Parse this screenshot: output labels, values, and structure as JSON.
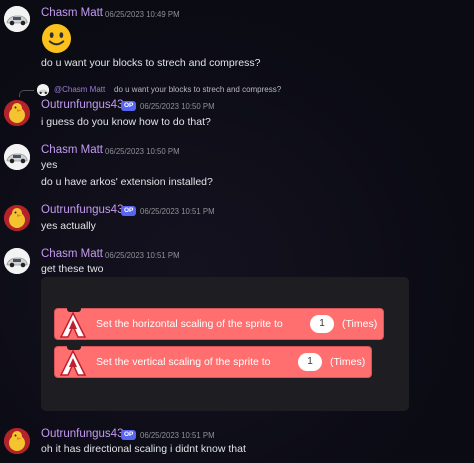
{
  "messages": [
    {
      "author": "Chasm Matt",
      "avatar": "car-avatar",
      "timestamp": "06/25/2023 10:49 PM",
      "emoji": "slightly-smiling-face",
      "lines": [
        "do u want your blocks to strech and compress?"
      ]
    },
    {
      "reply": {
        "mention": "@Chasm Matt",
        "text": "do u want your blocks to strech and compress?"
      },
      "author": "Outrunfungus43",
      "avatar": "duck-avatar",
      "badge": "OP",
      "timestamp": "06/25/2023 10:50 PM",
      "lines": [
        "i guess do you know how to do that?"
      ]
    },
    {
      "author": "Chasm Matt",
      "avatar": "car-avatar",
      "timestamp": "06/25/2023 10:50 PM",
      "lines": [
        "yes",
        "do u have arkos' extension installed?"
      ]
    },
    {
      "author": "Outrunfungus43",
      "avatar": "duck-avatar",
      "badge": "OP",
      "timestamp": "06/25/2023 10:51 PM",
      "lines": [
        "yes actually"
      ]
    },
    {
      "author": "Chasm Matt",
      "avatar": "car-avatar",
      "timestamp": "06/25/2023 10:51 PM",
      "lines": [
        "get these two"
      ],
      "embed": {
        "blocks": [
          {
            "icon": "a-logo-icon",
            "label": "Set the horizontal scaling of the sprite to",
            "value": "1",
            "suffix": "(Times)"
          },
          {
            "icon": "a-logo-icon",
            "label": "Set the vertical scaling of the sprite to",
            "value": "1",
            "suffix": "(Times)"
          }
        ]
      }
    },
    {
      "author": "Outrunfungus43",
      "avatar": "duck-avatar",
      "badge": "OP",
      "timestamp": "06/25/2023 10:51 PM",
      "lines": [
        "oh it has directional scaling i didnt know that"
      ]
    }
  ],
  "colors": {
    "background": "#0c0c16",
    "username": "#c49bf2",
    "badge": "#5865f2",
    "embed_bg": "#1e1e22",
    "block": "#ff6f6f"
  }
}
